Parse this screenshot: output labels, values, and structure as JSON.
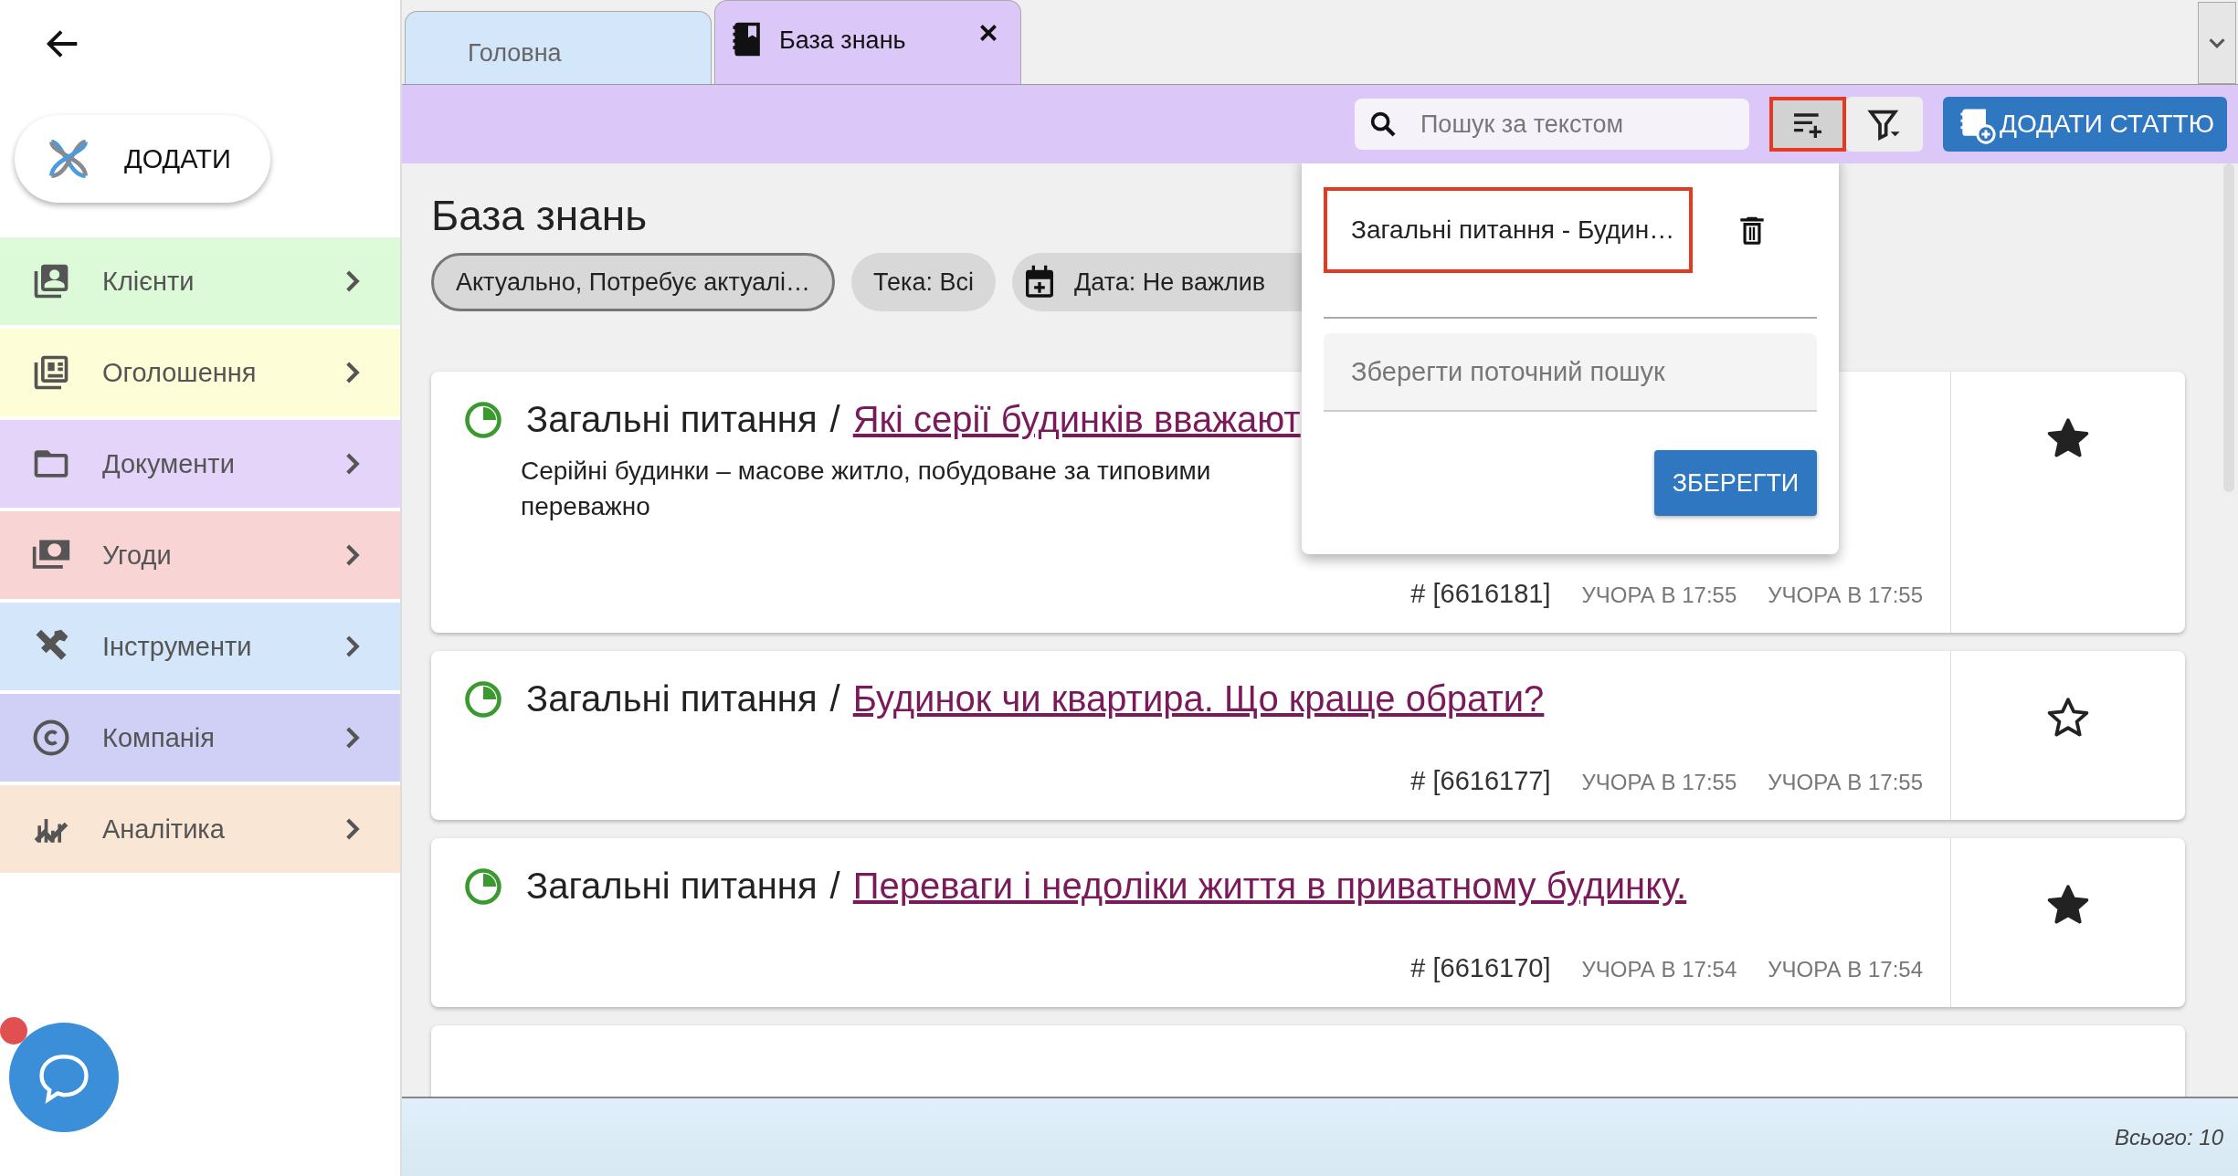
{
  "sidebar": {
    "add_button": "ДОДАТИ",
    "items": [
      {
        "label": "Клієнти",
        "color": "#dcf9d8"
      },
      {
        "label": "Оголошення",
        "color": "#fdfdd8"
      },
      {
        "label": "Документи",
        "color": "#e4d4fa"
      },
      {
        "label": "Угоди",
        "color": "#f8d4d4"
      },
      {
        "label": "Інструменти",
        "color": "#d4e6fa"
      },
      {
        "label": "Компанія",
        "color": "#d0d0f6"
      },
      {
        "label": "Аналітика",
        "color": "#fae6d4"
      }
    ],
    "chat": {
      "unread": true
    }
  },
  "tabs": [
    {
      "label": "Головна",
      "selected": false
    },
    {
      "label": "База знань",
      "selected": true
    }
  ],
  "toolbar": {
    "search": {
      "placeholder": "Пошук за текстом"
    },
    "buttons": [
      {
        "kind": "add-filter",
        "highlighted": true
      },
      {
        "kind": "filter",
        "highlighted": false
      }
    ],
    "add_article": "ДОДАТИ СТАТТЮ"
  },
  "popup": {
    "saved_searches": [
      {
        "label": "Загальні питання - Будин…",
        "highlighted": true
      }
    ],
    "save_field": {
      "placeholder": "Зберегти поточний пошук"
    },
    "save_button": "ЗБЕРЕГТИ"
  },
  "page": {
    "title": "База знань",
    "chips": [
      {
        "kind": "status",
        "label": "Актуально, Потребує актуалі…"
      },
      {
        "kind": "folder",
        "label": "Тека: Всі"
      },
      {
        "kind": "date",
        "label": "Дата: Не важлив"
      }
    ]
  },
  "articles": [
    {
      "category": "Загальні питання",
      "separator": "/",
      "title": "Які серії будинків вважают",
      "body": [
        "Серійні будинки – масове житло, побудоване за типовими",
        "переважно"
      ],
      "id": "# [6616181]",
      "created": "УЧОРА В 17:55",
      "updated": "УЧОРА В 17:55",
      "starred": true
    },
    {
      "category": "Загальні питання",
      "separator": "/",
      "title": "Будинок чи квартира. Що краще обрати?",
      "id": "# [6616177]",
      "created": "УЧОРА В 17:55",
      "updated": "УЧОРА В 17:55",
      "starred": false
    },
    {
      "category": "Загальні питання",
      "separator": "/",
      "title": "Переваги і недоліки життя в приватному будинку.",
      "id": "# [6616170]",
      "created": "УЧОРА В 17:54",
      "updated": "УЧОРА В 17:54",
      "starred": true
    }
  ],
  "footer": {
    "total": "Всього: 10"
  }
}
